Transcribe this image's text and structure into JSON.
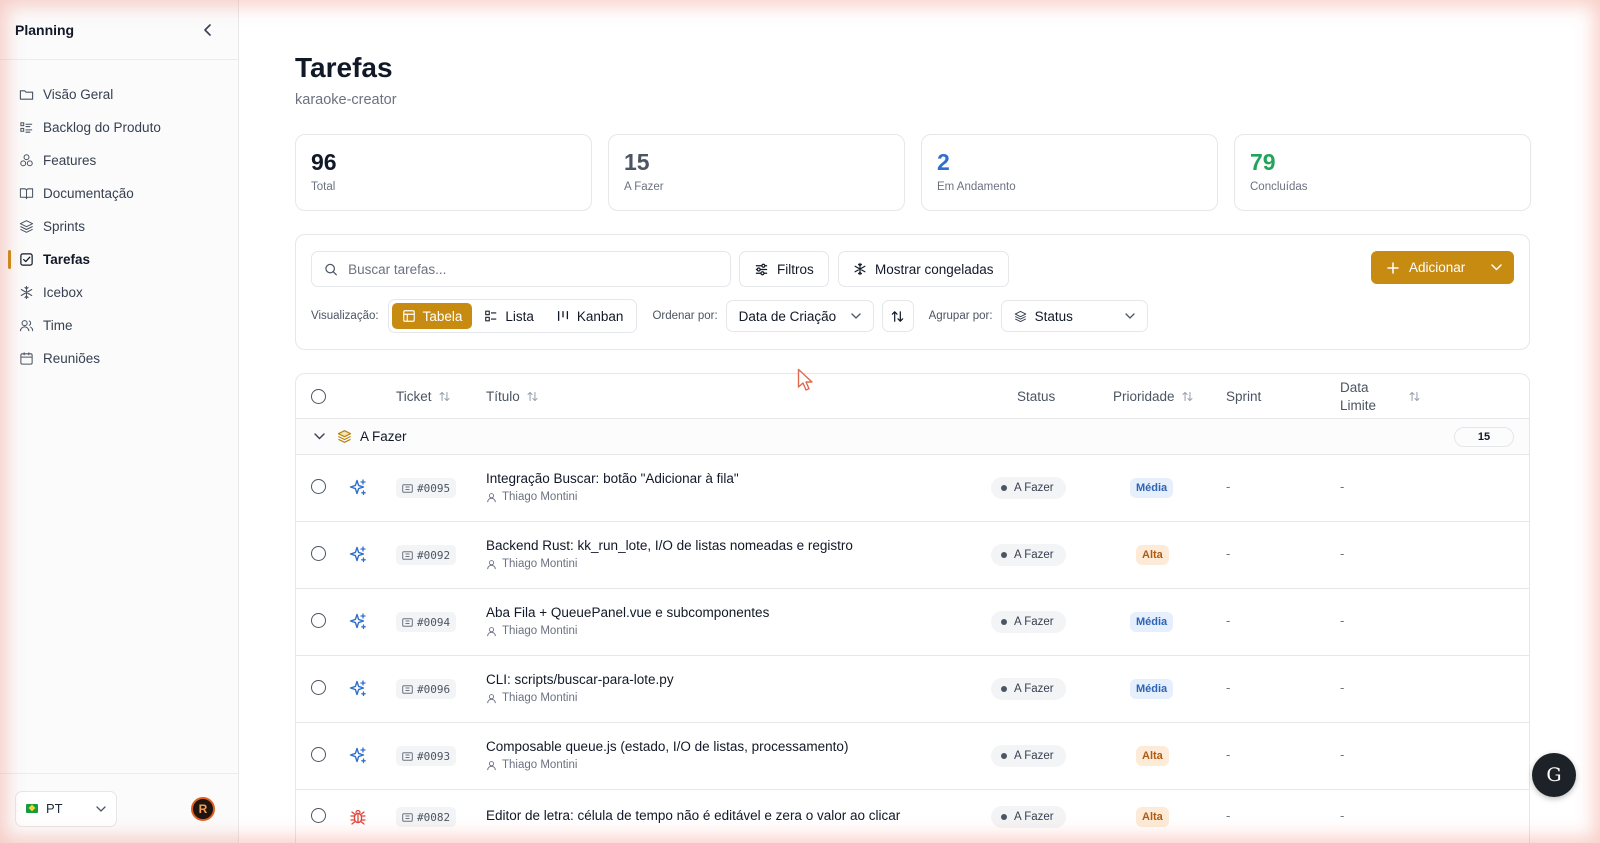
{
  "sidebar": {
    "title": "Planning",
    "items": [
      {
        "label": "Visão Geral",
        "icon": "folder-icon"
      },
      {
        "label": "Backlog do Produto",
        "icon": "list-icon"
      },
      {
        "label": "Features",
        "icon": "features-icon"
      },
      {
        "label": "Documentação",
        "icon": "book-icon"
      },
      {
        "label": "Sprints",
        "icon": "layers-icon"
      },
      {
        "label": "Tarefas",
        "icon": "checkbox-icon",
        "active": true
      },
      {
        "label": "Icebox",
        "icon": "snowflake-icon"
      },
      {
        "label": "Time",
        "icon": "users-icon"
      },
      {
        "label": "Reuniões",
        "icon": "calendar-icon"
      }
    ],
    "language": "PT",
    "avatar_initial": "R"
  },
  "page": {
    "title": "Tarefas",
    "subtitle": "karaoke-creator"
  },
  "stats": [
    {
      "value": "96",
      "label": "Total",
      "color": "#111827"
    },
    {
      "value": "15",
      "label": "A Fazer",
      "color": "#4b5563"
    },
    {
      "value": "2",
      "label": "Em Andamento",
      "color": "#2f6fcf"
    },
    {
      "value": "79",
      "label": "Concluídas",
      "color": "#22a55a"
    }
  ],
  "toolbar": {
    "search_placeholder": "Buscar tarefas...",
    "filters_label": "Filtros",
    "frozen_label": "Mostrar congeladas",
    "add_label": "Adicionar",
    "view_label": "Visualização:",
    "views": [
      "Tabela",
      "Lista",
      "Kanban"
    ],
    "sort_label": "Ordenar por:",
    "sort_value": "Data de Criação",
    "group_label": "Agrupar por:",
    "group_value": "Status"
  },
  "table": {
    "headers": {
      "ticket": "Ticket",
      "title": "Título",
      "status": "Status",
      "priority": "Prioridade",
      "sprint": "Sprint",
      "due_line1": "Data",
      "due_line2": "Limite"
    },
    "group": {
      "name": "A Fazer",
      "count": "15"
    },
    "rows": [
      {
        "ticket": "#0095",
        "title": "Integração Buscar: botão \"Adicionar à fila\"",
        "assignee": "Thiago Montini",
        "status": "A Fazer",
        "priority": "Média",
        "sprint": "-",
        "due": "-",
        "type": "feature"
      },
      {
        "ticket": "#0092",
        "title": "Backend Rust: kk_run_lote, I/O de listas nomeadas e registro",
        "assignee": "Thiago Montini",
        "status": "A Fazer",
        "priority": "Alta",
        "sprint": "-",
        "due": "-",
        "type": "feature"
      },
      {
        "ticket": "#0094",
        "title": "Aba Fila + QueuePanel.vue e subcomponentes",
        "assignee": "Thiago Montini",
        "status": "A Fazer",
        "priority": "Média",
        "sprint": "-",
        "due": "-",
        "type": "feature"
      },
      {
        "ticket": "#0096",
        "title": "CLI: scripts/buscar-para-lote.py",
        "assignee": "Thiago Montini",
        "status": "A Fazer",
        "priority": "Média",
        "sprint": "-",
        "due": "-",
        "type": "feature"
      },
      {
        "ticket": "#0093",
        "title": "Composable queue.js (estado, I/O de listas, processamento)",
        "assignee": "Thiago Montini",
        "status": "A Fazer",
        "priority": "Alta",
        "sprint": "-",
        "due": "-",
        "type": "feature"
      },
      {
        "ticket": "#0082",
        "title": "Editor de letra: célula de tempo não é editável e zera o valor ao clicar",
        "assignee": "",
        "status": "A Fazer",
        "priority": "Alta",
        "sprint": "-",
        "due": "-",
        "type": "bug"
      }
    ]
  },
  "fab_label": "G",
  "colors": {
    "accent": "#c88b12",
    "feature_icon": "#2f6fcf",
    "bug_icon": "#e0453a"
  }
}
